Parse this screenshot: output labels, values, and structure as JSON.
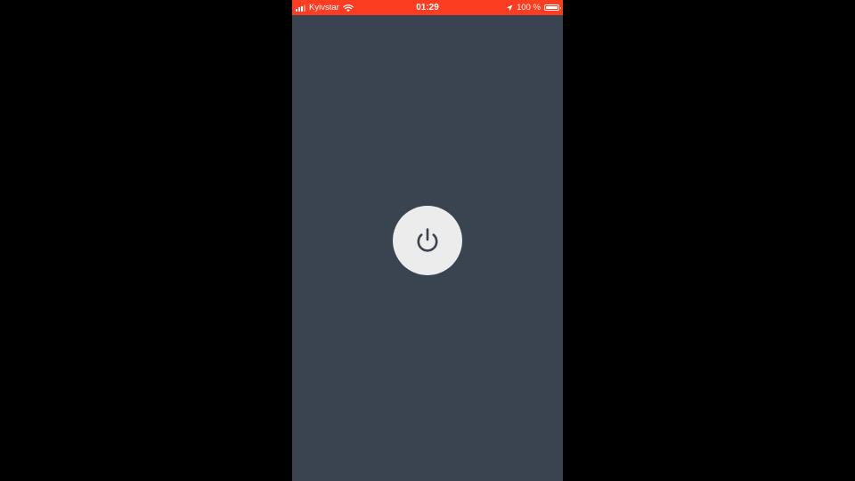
{
  "status_bar": {
    "carrier": "Kyivstar",
    "time": "01:29",
    "battery_percent": "100 %",
    "battery_level": 1.0,
    "color": "#fc3d21",
    "icons": [
      "signal-icon",
      "wifi-icon",
      "location-icon",
      "battery-icon"
    ]
  },
  "main": {
    "background_color": "#3a4450",
    "power_button": {
      "icon": "power-icon",
      "color": "#ececec",
      "icon_color": "#3a4450"
    }
  }
}
